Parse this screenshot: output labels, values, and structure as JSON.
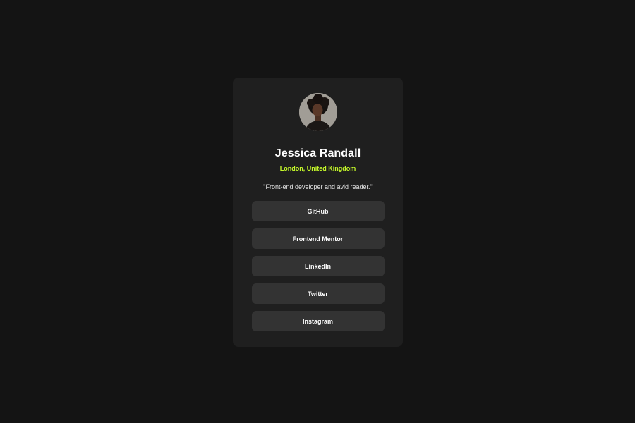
{
  "profile": {
    "name": "Jessica Randall",
    "location": "London, United Kingdom",
    "bio": "\"Front-end developer and avid reader.\""
  },
  "links": [
    {
      "label": "GitHub"
    },
    {
      "label": "Frontend Mentor"
    },
    {
      "label": "LinkedIn"
    },
    {
      "label": "Twitter"
    },
    {
      "label": "Instagram"
    }
  ],
  "colors": {
    "page_background": "#141414",
    "card_background": "#1f1f1f",
    "button_background": "#333333",
    "accent": "#c4f82a"
  }
}
